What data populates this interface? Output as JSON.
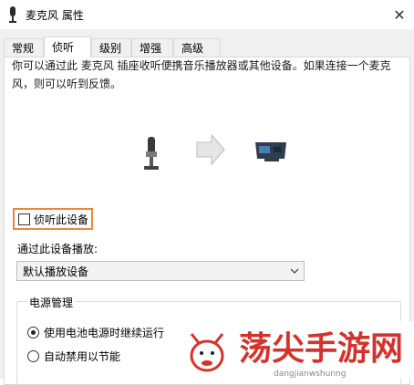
{
  "window": {
    "title": "麦克风 属性",
    "close_symbol": "✕"
  },
  "tabs": [
    "常规",
    "侦听",
    "级别",
    "增强",
    "高级"
  ],
  "listen_tab": {
    "description": "你可以通过此 麦克风 插座收听便携音乐播放器或其他设备。如果连接一个麦克风，则可以听到反馈。",
    "listen_checkbox": {
      "label": "侦听此设备",
      "checked": false
    },
    "playback_label": "通过此设备播放:",
    "playback_select": {
      "value": "默认播放设备"
    },
    "power": {
      "title": "电源管理",
      "options": [
        {
          "label": "使用电池电源时继续运行",
          "selected": true
        },
        {
          "label": "自动禁用以节能",
          "selected": false
        }
      ]
    }
  },
  "watermark": {
    "text": "荡尖手游网",
    "subtext": "dangjianwshunng"
  },
  "colors": {
    "highlight_border": "#e8893a",
    "watermark_red": "#d6322b"
  },
  "icons": [
    "microphone-icon",
    "close-icon",
    "mic-device-icon",
    "arrow-right-icon",
    "speaker-device-icon",
    "chevron-down-icon"
  ]
}
